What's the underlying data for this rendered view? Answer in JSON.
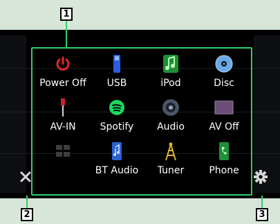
{
  "callouts": {
    "menu_area": "1",
    "close": "2",
    "setup": "3"
  },
  "tiles": [
    {
      "label": "Power Off",
      "icon": "power-icon"
    },
    {
      "label": "USB",
      "icon": "usb-icon"
    },
    {
      "label": "iPod",
      "icon": "music-note-icon"
    },
    {
      "label": "Disc",
      "icon": "disc-icon"
    },
    {
      "label": "AV-IN",
      "icon": "av-in-icon"
    },
    {
      "label": "Spotify",
      "icon": "spotify-icon"
    },
    {
      "label": "Audio",
      "icon": "speaker-icon"
    },
    {
      "label": "AV Off",
      "icon": "av-off-icon"
    },
    {
      "label": "",
      "icon": "grid-icon"
    },
    {
      "label": "BT Audio",
      "icon": "bt-audio-icon"
    },
    {
      "label": "Tuner",
      "icon": "antenna-icon"
    },
    {
      "label": "Phone",
      "icon": "phone-icon"
    }
  ],
  "colors": {
    "callout_line": "#2ed26b",
    "power_red": "#e0292a",
    "background": "#000000"
  }
}
